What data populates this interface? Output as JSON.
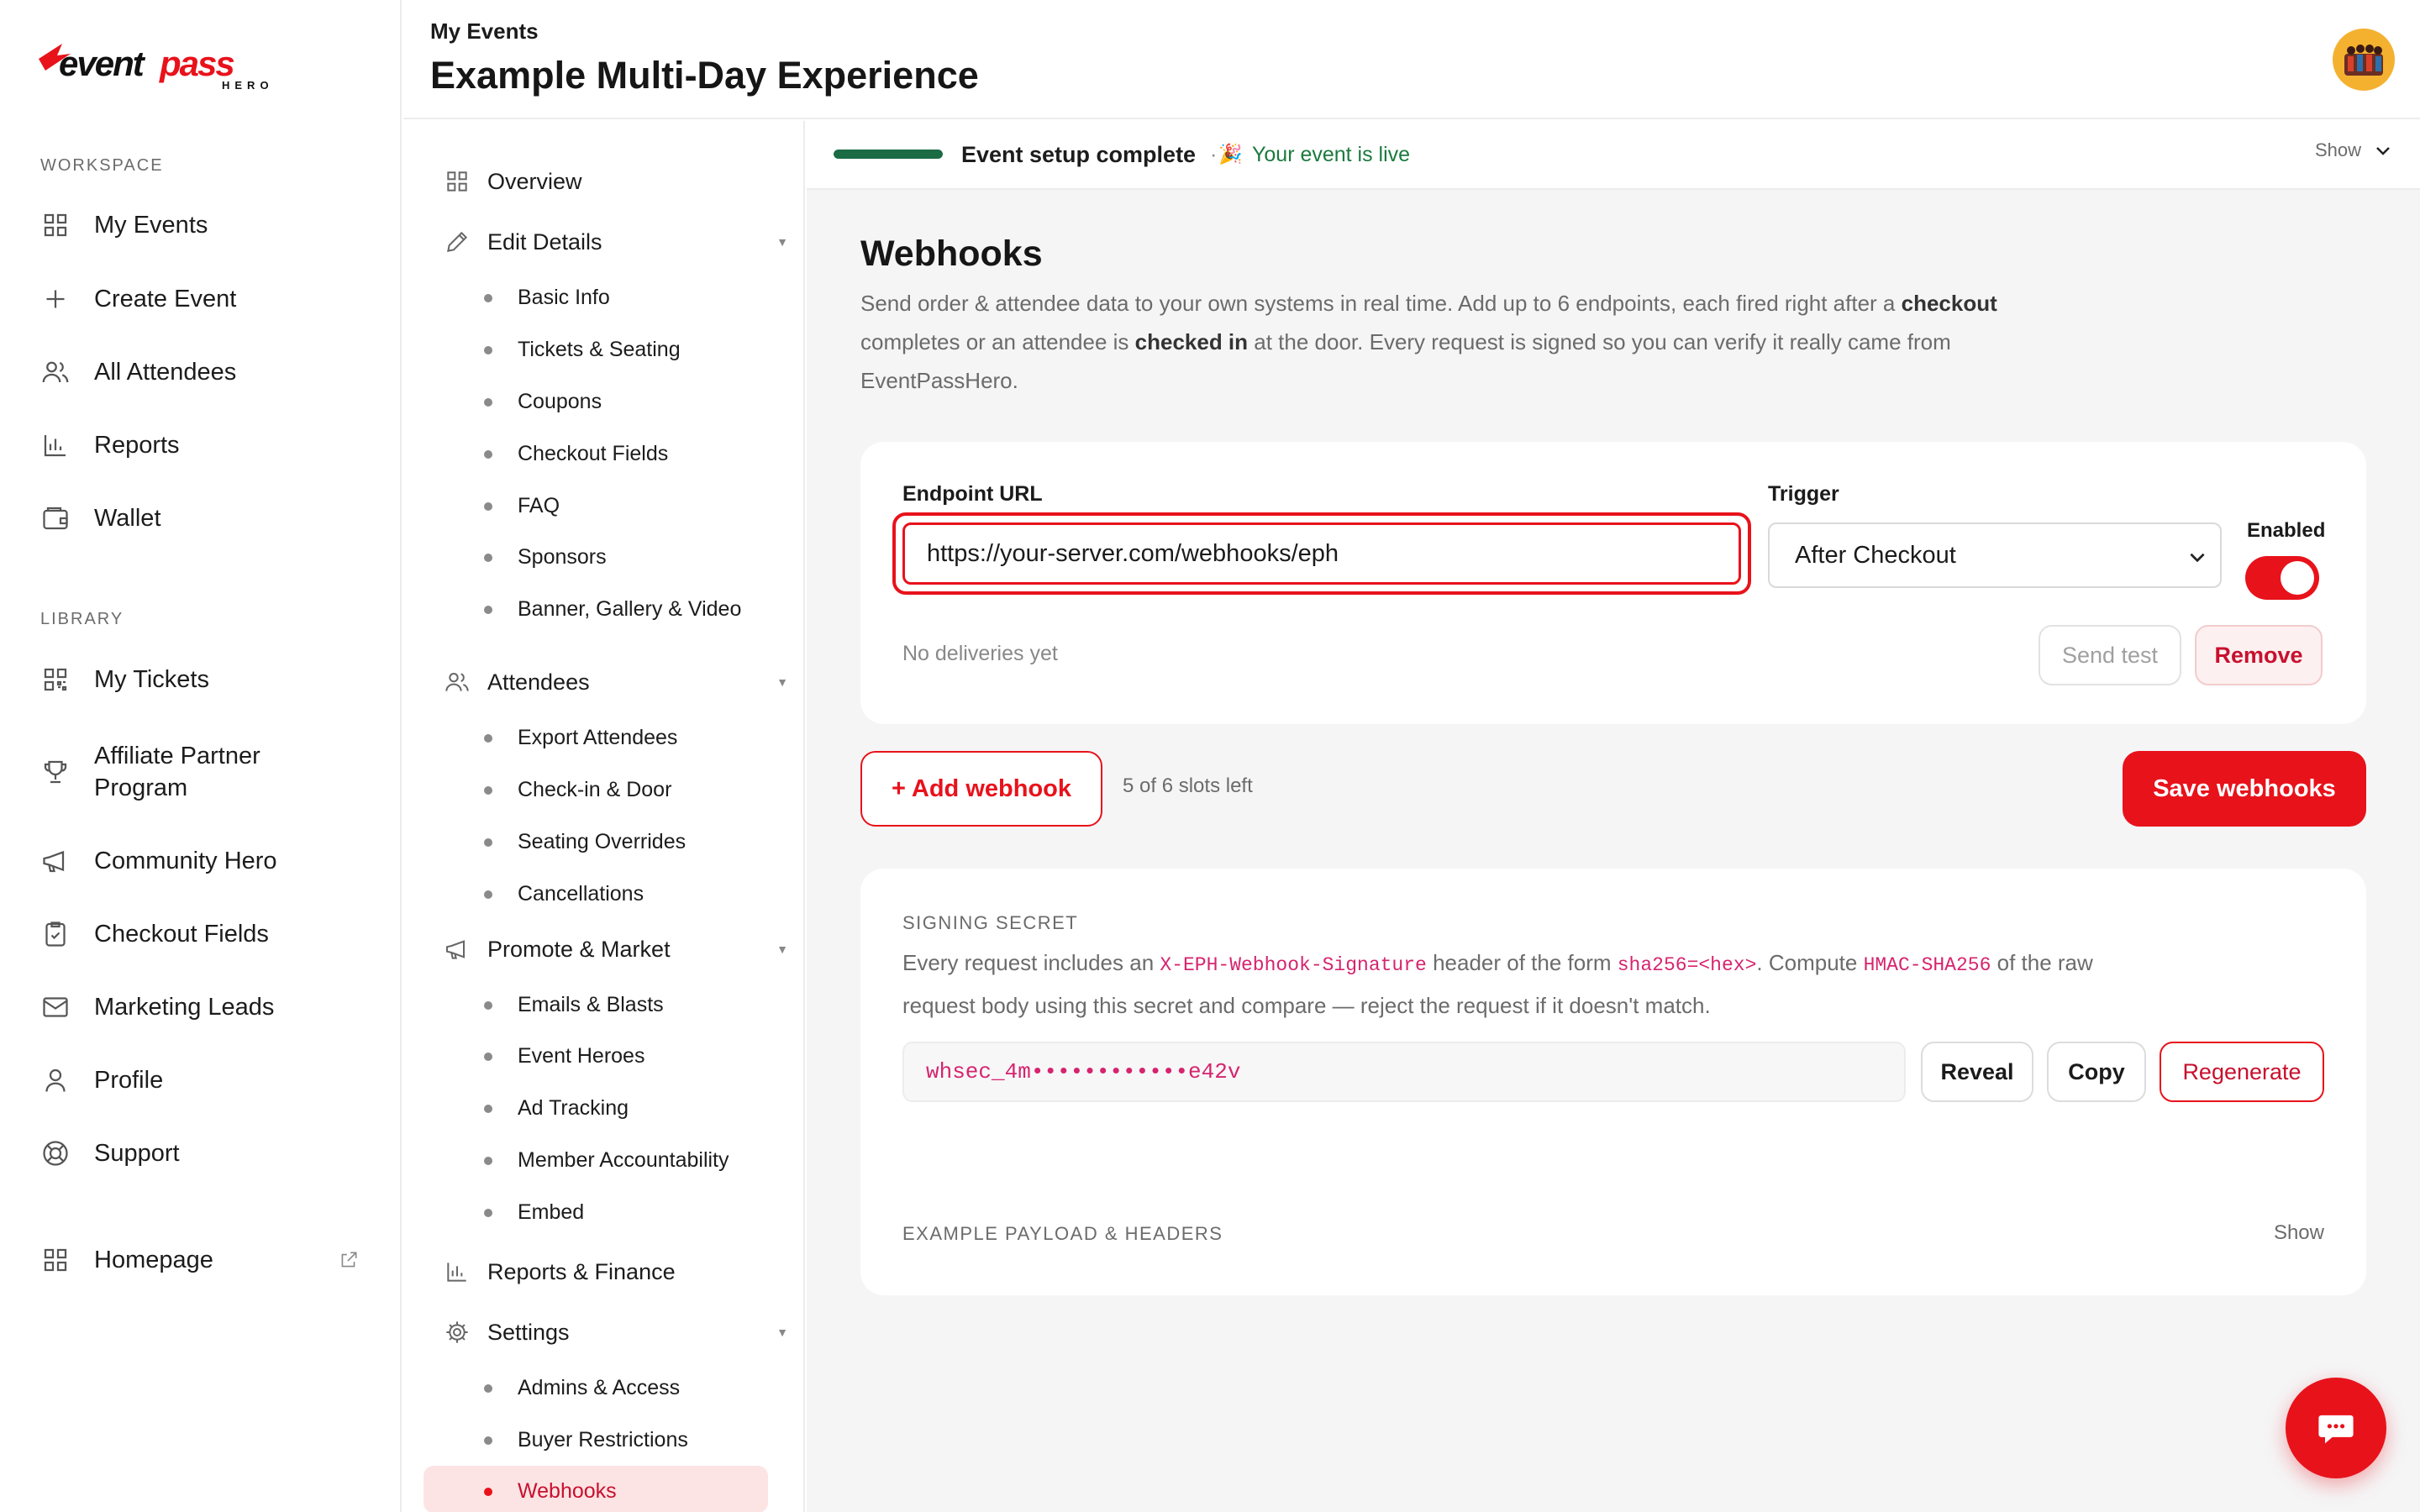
{
  "brand": {
    "name": "eventpass",
    "sub": "HERO"
  },
  "sidebar": {
    "workspace_label": "WORKSPACE",
    "workspace_items": [
      {
        "label": "My Events",
        "icon": "grid-icon"
      },
      {
        "label": "Create Event",
        "icon": "plus-icon"
      },
      {
        "label": "All Attendees",
        "icon": "users-icon"
      },
      {
        "label": "Reports",
        "icon": "bar-chart-icon"
      },
      {
        "label": "Wallet",
        "icon": "wallet-icon"
      }
    ],
    "library_label": "LIBRARY",
    "library_items": [
      {
        "label": "My Tickets",
        "icon": "qr-icon"
      },
      {
        "label": "Affiliate Partner Program",
        "icon": "trophy-icon"
      },
      {
        "label": "Community Hero",
        "icon": "megaphone-icon"
      },
      {
        "label": "Checkout Fields",
        "icon": "clipboard-icon"
      },
      {
        "label": "Marketing Leads",
        "icon": "mail-icon"
      },
      {
        "label": "Profile",
        "icon": "user-icon"
      },
      {
        "label": "Support",
        "icon": "lifebuoy-icon"
      }
    ],
    "homepage_label": "Homepage"
  },
  "header": {
    "breadcrumb": "My Events",
    "title": "Example Multi-Day Experience"
  },
  "subnav": {
    "overview": "Overview",
    "edit_details": "Edit Details",
    "edit_items": [
      "Basic Info",
      "Tickets & Seating",
      "Coupons",
      "Checkout Fields",
      "FAQ",
      "Sponsors",
      "Banner, Gallery & Video"
    ],
    "attendees": "Attendees",
    "attendee_items": [
      "Export Attendees",
      "Check-in & Door",
      "Seating Overrides",
      "Cancellations"
    ],
    "promote": "Promote & Market",
    "promote_items": [
      "Emails & Blasts",
      "Event Heroes",
      "Ad Tracking",
      "Member Accountability",
      "Embed"
    ],
    "reports": "Reports & Finance",
    "settings": "Settings",
    "settings_items": [
      "Admins & Access",
      "Buyer Restrictions",
      "Webhooks"
    ],
    "active_item": "Webhooks"
  },
  "status": {
    "progress": 1.0,
    "setup_label": "Event setup complete",
    "live_prefix": "·",
    "live_emoji": "🎉",
    "live_label": "Your event is live",
    "show_label": "Show"
  },
  "page": {
    "title": "Webhooks",
    "desc_1": "Send order & attendee data to your own systems in real time. Add up to 6 endpoints, each fired right after a ",
    "desc_b1": "checkout",
    "desc_2": " completes or an attendee is ",
    "desc_b2": "checked in",
    "desc_3": " at the door. Every request is signed so you can verify it really came from EventPassHero."
  },
  "webhook": {
    "endpoint_label": "Endpoint URL",
    "endpoint_value": "https://your-server.com/webhooks/eph",
    "trigger_label": "Trigger",
    "trigger_value": "After Checkout",
    "enabled_label": "Enabled",
    "enabled": true,
    "deliveries": "No deliveries yet",
    "send_test": "Send test",
    "remove": "Remove"
  },
  "actions": {
    "add": "+ Add webhook",
    "slots": "5 of 6 slots left",
    "save": "Save webhooks"
  },
  "signing": {
    "label": "SIGNING SECRET",
    "t1": "Every request includes an ",
    "c1": "X-EPH-Webhook-Signature",
    "t2": " header of the form ",
    "c2": "sha256=<hex>",
    "t3": ". Compute ",
    "c3": "HMAC-SHA256",
    "t4": " of the raw request body using this secret and compare — reject the request if it doesn't match.",
    "secret": "whsec_4m••••••••••••e42v",
    "reveal": "Reveal",
    "copy": "Copy",
    "regenerate": "Regenerate"
  },
  "payload": {
    "label": "EXAMPLE PAYLOAD & HEADERS",
    "show": "Show"
  },
  "colors": {
    "accent": "#e8121b",
    "progress": "#1b6b44",
    "live": "#1b7a3e",
    "code": "#d6246e"
  }
}
